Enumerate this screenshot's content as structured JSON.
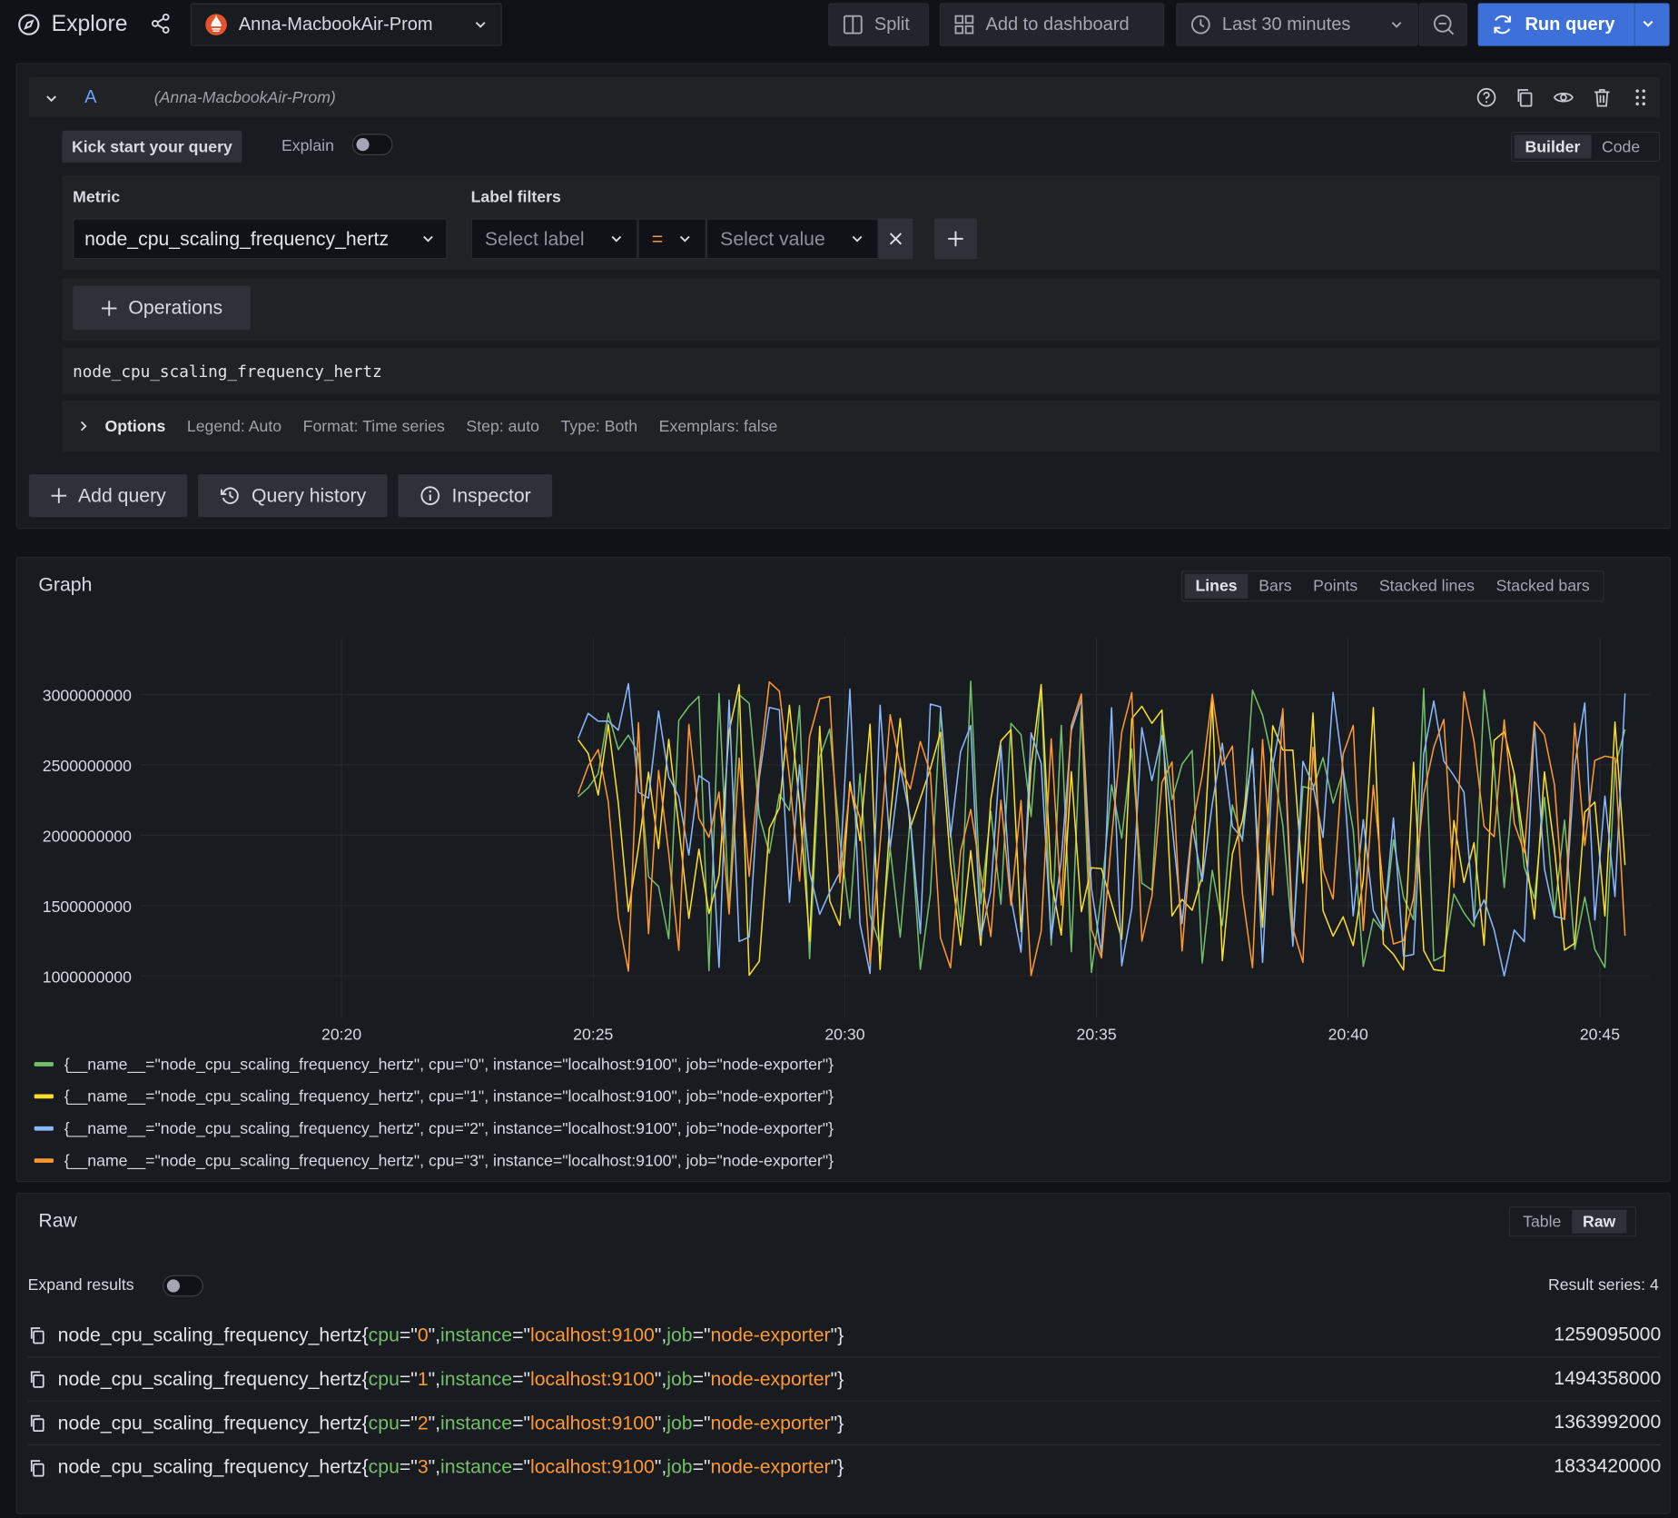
{
  "topbar": {
    "title": "Explore",
    "datasource": "Anna-MacbookAir-Prom",
    "split_label": "Split",
    "add_dashboard_label": "Add to dashboard",
    "time_range": "Last 30 minutes",
    "run_label": "Run query"
  },
  "query": {
    "letter": "A",
    "datasource_hint": "(Anna-MacbookAir-Prom)",
    "kickstart_label": "Kick start your query",
    "explain_label": "Explain",
    "modes": [
      "Builder",
      "Code"
    ],
    "active_mode": "Builder",
    "metric_label": "Metric",
    "metric_value": "node_cpu_scaling_frequency_hertz",
    "label_filters_label": "Label filters",
    "label_placeholder": "Select label",
    "operator": "=",
    "value_placeholder": "Select value",
    "operations_label": "Operations",
    "preview": "node_cpu_scaling_frequency_hertz",
    "options": {
      "title": "Options",
      "legend": "Legend: Auto",
      "format": "Format: Time series",
      "step": "Step: auto",
      "type": "Type: Both",
      "exemplars": "Exemplars: false"
    },
    "buttons": {
      "add_query": "Add query",
      "history": "Query history",
      "inspector": "Inspector"
    }
  },
  "graph": {
    "title": "Graph",
    "types": [
      "Lines",
      "Bars",
      "Points",
      "Stacked lines",
      "Stacked bars"
    ],
    "active_type": "Lines"
  },
  "chart_data": {
    "type": "line",
    "title": "",
    "xlabel": "",
    "ylabel": "",
    "x_ticks": [
      "20:20",
      "20:25",
      "20:30",
      "20:35",
      "20:40",
      "20:45"
    ],
    "y_ticks": [
      1000000000,
      1500000000,
      2000000000,
      2500000000,
      3000000000
    ],
    "x_range": [
      "20:16",
      "20:46"
    ],
    "ylim": [
      700000000,
      3400000000
    ],
    "grid": true,
    "legend_position": "bottom",
    "series": [
      {
        "name": "{__name__=\"node_cpu_scaling_frequency_hertz\", cpu=\"0\", instance=\"localhost:9100\", job=\"node-exporter\"}",
        "color": "#73bf69",
        "seed": 11
      },
      {
        "name": "{__name__=\"node_cpu_scaling_frequency_hertz\", cpu=\"1\", instance=\"localhost:9100\", job=\"node-exporter\"}",
        "color": "#fade2a",
        "seed": 23
      },
      {
        "name": "{__name__=\"node_cpu_scaling_frequency_hertz\", cpu=\"2\", instance=\"localhost:9100\", job=\"node-exporter\"}",
        "color": "#8ab8ff",
        "seed": 37
      },
      {
        "name": "{__name__=\"node_cpu_scaling_frequency_hertz\", cpu=\"3\", instance=\"localhost:9100\", job=\"node-exporter\"}",
        "color": "#ff9830",
        "seed": 53
      }
    ]
  },
  "raw": {
    "title": "Raw",
    "toggle": [
      "Table",
      "Raw"
    ],
    "active_toggle": "Raw",
    "expand_label": "Expand results",
    "series_count": "Result series: 4",
    "rows": [
      {
        "metric": "node_cpu_scaling_frequency_hertz",
        "cpu": "0",
        "instance": "localhost:9100",
        "job": "node-exporter",
        "value": "1259095000"
      },
      {
        "metric": "node_cpu_scaling_frequency_hertz",
        "cpu": "1",
        "instance": "localhost:9100",
        "job": "node-exporter",
        "value": "1494358000"
      },
      {
        "metric": "node_cpu_scaling_frequency_hertz",
        "cpu": "2",
        "instance": "localhost:9100",
        "job": "node-exporter",
        "value": "1363992000"
      },
      {
        "metric": "node_cpu_scaling_frequency_hertz",
        "cpu": "3",
        "instance": "localhost:9100",
        "job": "node-exporter",
        "value": "1833420000"
      }
    ]
  }
}
